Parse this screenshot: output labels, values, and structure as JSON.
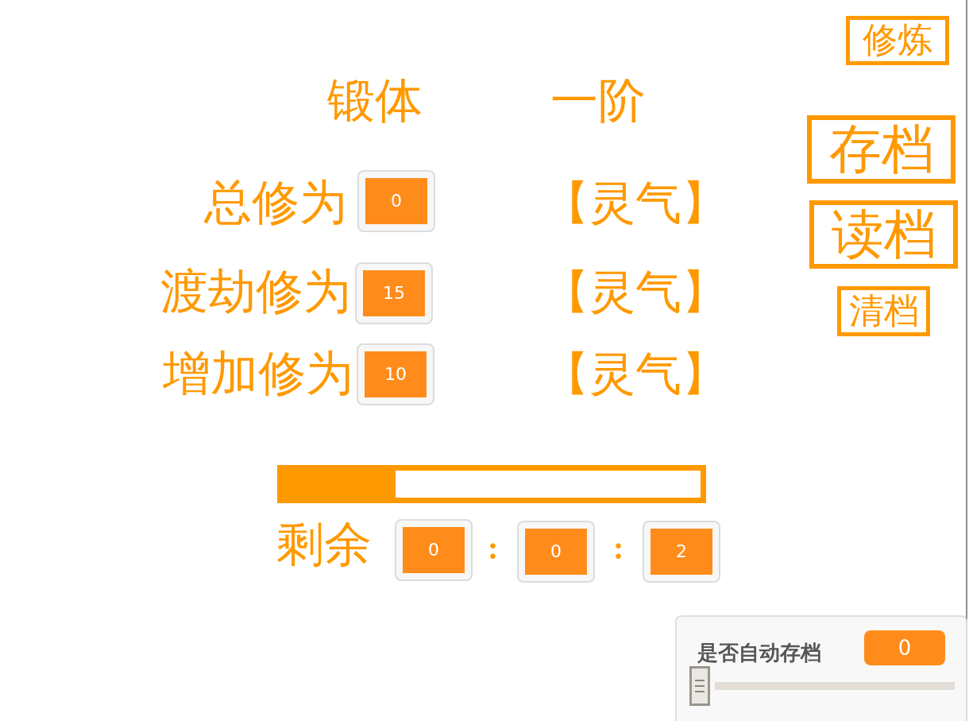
{
  "header": [
    {
      "text": "锻体"
    },
    {
      "text": "一阶"
    }
  ],
  "stats": [
    {
      "label": "总修为",
      "value": "0",
      "unit": "【灵气】"
    },
    {
      "label": "渡劫修为",
      "value": "15",
      "unit": "【灵气】"
    },
    {
      "label": "增加修为",
      "value": "10",
      "unit": "【灵气】"
    }
  ],
  "progress": {
    "level": 0.27
  },
  "timer": {
    "label": "剩余",
    "parts": [
      "0",
      "0",
      "2"
    ],
    "separators": [
      ":",
      ":"
    ]
  },
  "buttons": [
    {
      "label": "修炼",
      "kind": "small"
    },
    {
      "label": "存档",
      "kind": "large"
    },
    {
      "label": "读档",
      "kind": "large"
    },
    {
      "label": "清档",
      "kind": "small"
    }
  ],
  "slider_monitor": {
    "label": "是否自动存档",
    "value": "0",
    "level": 0
  }
}
